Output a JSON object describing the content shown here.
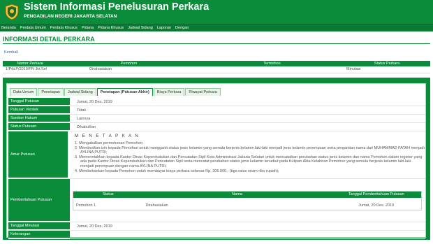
{
  "header": {
    "title": "Sistem Informasi Penelusuran Perkara",
    "subtitle": "PENGADILAN NEGERI JAKARTA SELATAN",
    "logo_icon": "court-emblem-icon"
  },
  "nav": {
    "items": [
      "Beranda",
      "Perdata Umum",
      "Perdata Khusus",
      "Pidana",
      "Pidana Khusus",
      "Jadwal Sidang",
      "Laporan",
      "Dengan"
    ]
  },
  "page": {
    "section_title": "INFORMASI DETAIL PERKARA",
    "back_link": "Kembali"
  },
  "summary": {
    "headers": [
      "Nomor Perkara",
      "Pemohon",
      "Termohon",
      "Status Perkara"
    ],
    "row": [
      "1/Pdt.P/2019/PN Jkt.Sel",
      "Dirahasiakan",
      "",
      "Minutasi"
    ]
  },
  "tabs": {
    "items": [
      "Data Umum",
      "Penetapan",
      "Jadwal Sidang",
      "Penetapan (Putusan Akhir)",
      "Biaya Perkara",
      "Riwayat Perkara"
    ],
    "active_index": 3
  },
  "detail": {
    "labels": {
      "tanggal_putusan": "Tanggal Putusan",
      "putusan_verstek": "Putusan Verstek",
      "sumber_hukum": "Sumber Hukum",
      "status_putusan": "Status Putusan",
      "amar_putusan": "Amar Putusan",
      "pemberitahuan": "Pemberitahuan Putusan",
      "tanggal_minutasi": "Tanggal Minutasi",
      "keterangan": "Keterangan"
    },
    "values": {
      "tanggal_putusan": "Jumat, 20 Des. 2019",
      "putusan_verstek": "Tidak",
      "sumber_hukum": "Lainnya",
      "status_putusan": "Dikabulkan",
      "tanggal_minutasi": "Jumat, 20 Des. 2019",
      "keterangan": ""
    },
    "amar": {
      "heading": "M E N E T A P K A N",
      "items": [
        "1. Mengabulkan permohonan Pemohon;",
        "2. Memberikan izin kepada Pemohon untuk mengganti status jenis kelamin yang semula berjenis kelamin laki-laki menjadi jenis kelamin perempuan serta pergantian nama dari MUHAMMAD FATAH menjadi AYLINA PUTRI;",
        "3. Memerintahkan kepada Kantor Dinas Kependudukan dan Pencatatan Sipil Kota Administrasi Jakarta Selatan untuk mencatatkan perubahan status jenis kelamin dan nama Pemohon dalam register yang ada pada Kantor Dinas Kependudukan dan Pencatatan Sipil serta mencatat perubahan status jenis kelamin tersebut pada Kutipan Akta Kelahiran Pemohon yang semula berjenis kelamin laki-laki menjadi perempuan dengan nama AYLINA PUTRI;",
        "4. Membebankan kepada Pemohon untuk membayar biaya perkara sebesar Rp. 306.000,- (tiga ratus enam ribu rupiah);"
      ]
    },
    "pemberitahuan_table": {
      "headers": [
        "Status",
        "Nama",
        "Tanggal Pemberitahuan Putusan"
      ],
      "row": [
        "Pemohon 1",
        "Dirahasiakan",
        "Jumat, 20 Des. 2019"
      ]
    }
  }
}
